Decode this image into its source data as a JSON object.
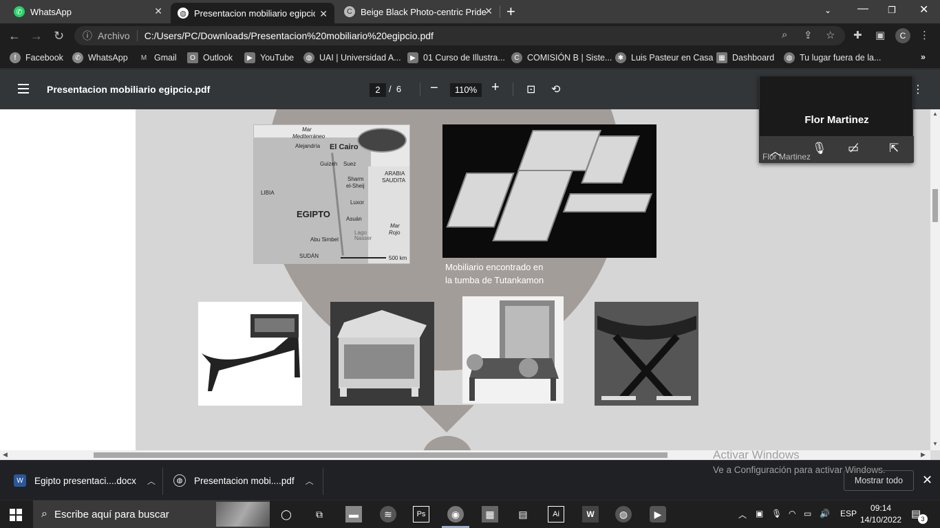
{
  "browser": {
    "tabs": [
      {
        "title": "WhatsApp",
        "icon": "whatsapp-icon"
      },
      {
        "title": "Presentacion mobiliario egipcio.p",
        "icon": "globe-icon"
      },
      {
        "title": "Beige Black Photo-centric Pride S",
        "icon": "canva-icon"
      }
    ],
    "address": {
      "scheme_label": "Archivo",
      "url": "C:/Users/PC/Downloads/Presentacion%20mobiliario%20egipcio.pdf"
    },
    "profile_initial": "C",
    "bookmarks": [
      {
        "label": "Facebook",
        "icon": "facebook-icon"
      },
      {
        "label": "WhatsApp",
        "icon": "whatsapp-icon"
      },
      {
        "label": "Gmail",
        "icon": "gmail-icon"
      },
      {
        "label": "Outlook",
        "icon": "outlook-icon"
      },
      {
        "label": "YouTube",
        "icon": "youtube-icon"
      },
      {
        "label": "UAI | Universidad A...",
        "icon": "globe-icon"
      },
      {
        "label": "01 Curso de Illustra...",
        "icon": "youtube-icon"
      },
      {
        "label": "COMISIÓN B | Siste...",
        "icon": "canva-icon"
      },
      {
        "label": "Luis Pasteur en Casa",
        "icon": "site-icon"
      },
      {
        "label": "Dashboard",
        "icon": "site-icon"
      },
      {
        "label": "Tu lugar fuera de la...",
        "icon": "globe-icon"
      }
    ]
  },
  "pdf": {
    "title": "Presentacion mobiliario egipcio.pdf",
    "current_page": "2",
    "total_pages": "6",
    "zoom": "110%",
    "caption_line1": "Mobiliario encontrado en",
    "caption_line2": "la tumba de Tutankamon",
    "map_labels": {
      "sea": "Mar",
      "sea2": "Mediterráneo",
      "alejandria": "Alejandría",
      "cairo": "El Cairo",
      "guizeh": "Guizeh",
      "suez": "Suez",
      "arabia": "ARABIA",
      "saudita": "SAUDITA",
      "libia": "LIBIA",
      "sharm": "Sharm",
      "sheij": "el-Sheij",
      "egipto": "EGIPTO",
      "luxor": "Luxor",
      "asuan": "Asuán",
      "lago": "Lago",
      "nasser": "Nasser",
      "abu": "Abu Simbel",
      "marrojo1": "Mar",
      "marrojo2": "Rojo",
      "sudan": "SUDÁN",
      "scale": "500 km"
    }
  },
  "video_call": {
    "name": "Flor Martinez",
    "sub_label": "Flor Martinez"
  },
  "downloads": [
    {
      "label": "Egipto presentaci....docx",
      "icon": "word-icon"
    },
    {
      "label": "Presentacion mobi....pdf",
      "icon": "pdf-icon"
    }
  ],
  "downloads_show_all": "Mostrar todo",
  "watermark": {
    "line1": "Activar Windows",
    "line2": "Ve a Configuración para activar Windows."
  },
  "taskbar": {
    "search_placeholder": "Escribe aquí para buscar",
    "language": "ESP",
    "time": "09:14",
    "date": "14/10/2022",
    "notifications": "3"
  },
  "colors": {
    "accent": "#323639",
    "page": "#d6d6d6",
    "circle": "#a39d99"
  }
}
